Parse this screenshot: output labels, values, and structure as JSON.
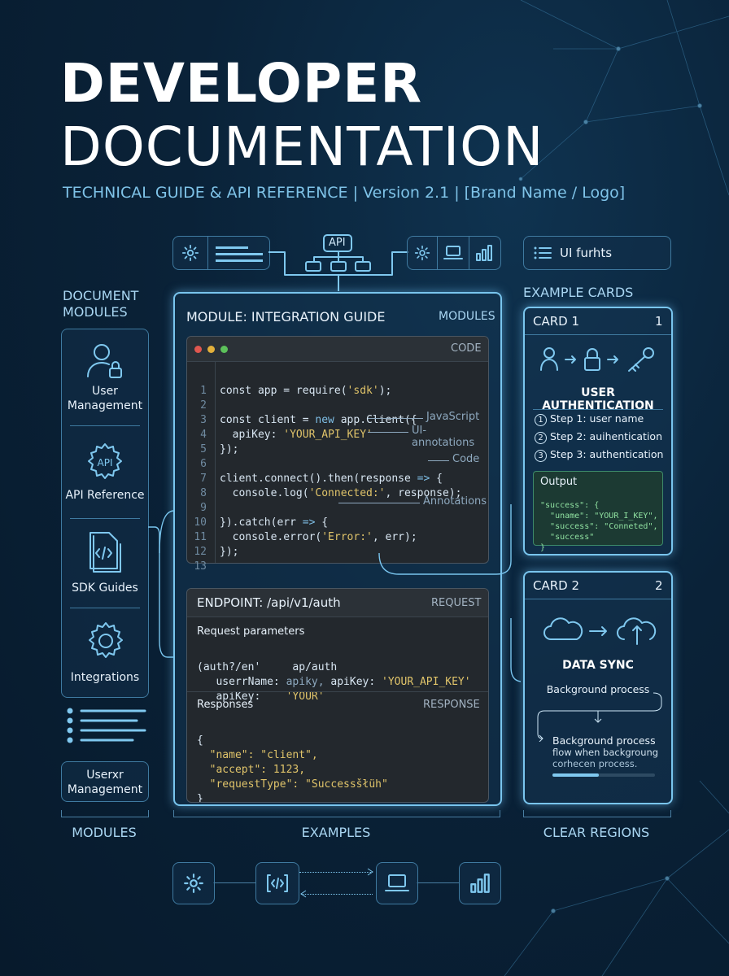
{
  "header": {
    "title_line1": "DEVELOPER",
    "title_line2": "DOCUMENTATION",
    "subtitle": "TECHNICAL GUIDE & API REFERENCE | Version 2.1 | [Brand Name / Logo]"
  },
  "top_bar": {
    "api_label": "API",
    "ui_hints_label": "UI furhts"
  },
  "sidebar": {
    "title_line1": "DOCUMENT",
    "title_line2": "MODULES",
    "items": [
      {
        "label_line1": "User",
        "label_line2": "Management",
        "icon": "user-lock-icon"
      },
      {
        "label_line1": "API Reference",
        "label_line2": "",
        "icon": "api-gear-icon"
      },
      {
        "label_line1": "SDK Guides",
        "label_line2": "",
        "icon": "code-file-icon"
      },
      {
        "label_line1": "Integrations",
        "label_line2": "",
        "icon": "gear-icon"
      }
    ],
    "bottom_button_line1": "Userxr",
    "bottom_button_line2": "Management",
    "footer_label": "MODULES"
  },
  "main": {
    "title": "MODULE: INTEGRATION GUIDE",
    "tag": "MODULES",
    "code_window": {
      "tag": "CODE",
      "line_numbers": [
        "1",
        "2",
        "3",
        "4",
        "5",
        "6",
        "7",
        "8",
        "9",
        "10",
        "11",
        "12",
        "13"
      ],
      "annotations": [
        "JavaScript",
        "UI-annotations",
        "Code",
        "Annotations"
      ]
    },
    "endpoint": {
      "title": "ENDPOINT: /api/v1/auth",
      "tag": "REQUEST",
      "params_title": "Request parameters",
      "param_lines": [
        [
          "(auth?/en'",
          "ap/auth"
        ],
        [
          "userrName:",
          "apiky,",
          "apiKey:",
          "'YOUR_API_KEY'"
        ],
        [
          "apiKey:",
          "'YOUR'"
        ]
      ],
      "responses_title": "Responses",
      "responses_tag": "RESPONSE",
      "response_lines": [
        "{",
        "\"name\": \"client\",",
        "\"accept\": 1123,",
        "\"requestType\": \"Successšłüh\"",
        "}"
      ]
    },
    "footer_label": "EXAMPLES"
  },
  "right": {
    "title": "EXAMPLE CARDS",
    "card1": {
      "name": "CARD 1",
      "number": "1",
      "heading": "USER AUTHENTICATION",
      "steps": [
        "Step 1: user name",
        "Step 2: auihentication",
        "Step 3: authentication"
      ],
      "step_marks": [
        "1",
        "2",
        "3"
      ],
      "output_title": "Output",
      "output_lines": [
        "\"success\": {",
        "\"uname\": \"YOUR_I_KEY\",",
        "\"success\": \"Conneted\",",
        "\"success\"",
        "}"
      ]
    },
    "card2": {
      "name": "CARD 2",
      "number": "2",
      "heading": "DATA SYNC",
      "text1": "Background process",
      "text2": "Background process",
      "text3": "flow when backgroung",
      "text4": "corhecen process.",
      "progress": 0.45
    },
    "footer_label": "CLEAR REGIONS"
  },
  "colors": {
    "accent": "#79c5ee",
    "background": "#0a2238",
    "code_bg": "#23282d",
    "string": "#e0c46a",
    "keyword": "#7fbfe6",
    "output_green": "#8fe0a0"
  }
}
